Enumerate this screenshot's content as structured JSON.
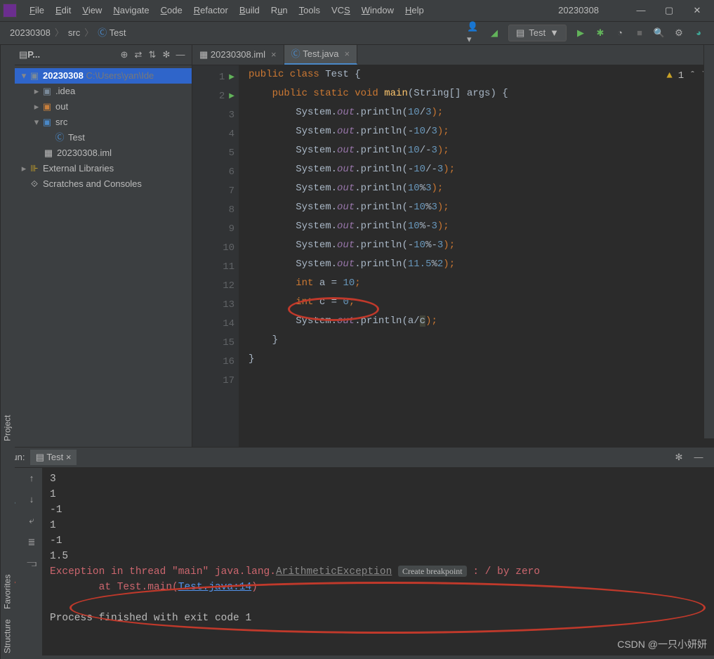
{
  "window": {
    "title": "20230308"
  },
  "menu": [
    "File",
    "Edit",
    "View",
    "Navigate",
    "Code",
    "Refactor",
    "Build",
    "Run",
    "Tools",
    "VCS",
    "Window",
    "Help"
  ],
  "breadcrumb": {
    "root": "20230308",
    "mid": "src",
    "leaf": "Test"
  },
  "toolbar": {
    "run_config": "Test"
  },
  "project": {
    "label": "P...",
    "root": {
      "name": "20230308",
      "path": "C:\\Users\\yan\\Ide"
    },
    "nodes": [
      ".idea",
      "out",
      "src",
      "Test",
      "20230308.iml",
      "External Libraries",
      "Scratches and Consoles"
    ]
  },
  "tabs": [
    {
      "name": "20230308.iml"
    },
    {
      "name": "Test.java"
    }
  ],
  "gutter_lines": [
    "1",
    "2",
    "3",
    "4",
    "5",
    "6",
    "7",
    "8",
    "9",
    "10",
    "11",
    "12",
    "13",
    "14",
    "15",
    "16",
    "17"
  ],
  "warning": {
    "count": "1"
  },
  "code": {
    "l1": {
      "a": "public class ",
      "b": "Test {"
    },
    "l2": {
      "a": "    public static void ",
      "b": "main",
      "c": "(String[] args) {"
    },
    "l3": {
      "a": "        System.",
      "b": "out",
      "c": ".println(",
      "d": "10",
      "e": "/",
      "f": "3",
      "g": ");"
    },
    "l4": {
      "a": "        System.",
      "b": "out",
      "c": ".println(-",
      "d": "10",
      "e": "/",
      "f": "3",
      "g": ");"
    },
    "l5": {
      "a": "        System.",
      "b": "out",
      "c": ".println(",
      "d": "10",
      "e": "/-",
      "f": "3",
      "g": ");"
    },
    "l6": {
      "a": "        System.",
      "b": "out",
      "c": ".println(-",
      "d": "10",
      "e": "/-",
      "f": "3",
      "g": ");"
    },
    "l7": {
      "a": "        System.",
      "b": "out",
      "c": ".println(",
      "d": "10",
      "e": "%",
      "f": "3",
      "g": ");"
    },
    "l8": {
      "a": "        System.",
      "b": "out",
      "c": ".println(-",
      "d": "10",
      "e": "%",
      "f": "3",
      "g": ");"
    },
    "l9": {
      "a": "        System.",
      "b": "out",
      "c": ".println(",
      "d": "10",
      "e": "%-",
      "f": "3",
      "g": ");"
    },
    "l10": {
      "a": "        System.",
      "b": "out",
      "c": ".println(-",
      "d": "10",
      "e": "%-",
      "f": "3",
      "g": ");"
    },
    "l11": {
      "a": "        System.",
      "b": "out",
      "c": ".println(",
      "d": "11.5",
      "e": "%",
      "f": "2",
      "g": ");"
    },
    "l12": {
      "a": "        int ",
      "b": "a = ",
      "c": "10",
      "d": ";"
    },
    "l13": {
      "a": "        int ",
      "b": "c = ",
      "c": "0",
      "d": ";"
    },
    "l14": {
      "a": "        System.",
      "b": "out",
      "c": ".println(a/",
      "d": "c",
      "e": ");"
    },
    "l15": "    }",
    "l16": "}"
  },
  "run": {
    "label": "Run:",
    "tab": "Test",
    "out": [
      "3",
      "1",
      "-1",
      "1",
      "-1",
      "1.5"
    ],
    "err1a": "Exception in thread \"main\" java.lang.",
    "err1b": "ArithmeticException",
    "err1c": "Create breakpoint",
    "err1d": ": / by zero",
    "err2a": "\tat Test.main(",
    "err2b": "Test.java:14",
    "err2c": ")",
    "exit": "Process finished with exit code 1"
  },
  "sidestrip": {
    "a": "Project",
    "b": "Structure",
    "c": "Favorites"
  },
  "watermark": "CSDN @一只小妍妍"
}
